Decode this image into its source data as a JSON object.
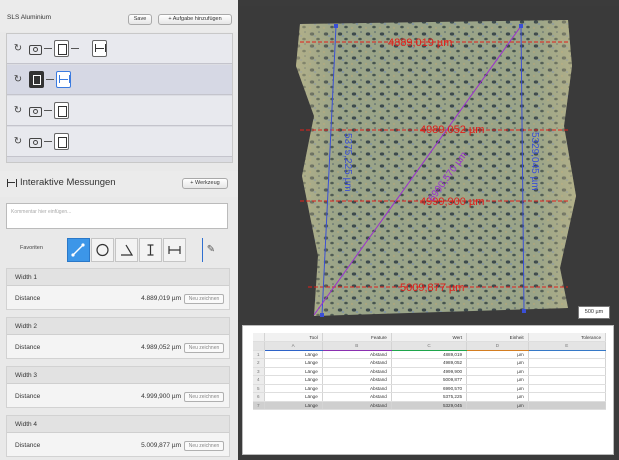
{
  "left": {
    "project_title": "SLS Aluminium",
    "save_label": "Save",
    "add_task_label": "+ Aufgabe hinzufügen"
  },
  "interactive": {
    "title": "Interaktive Messungen",
    "tool_button": "+ Werkzeug",
    "comment_placeholder": "Kommentar hier einfügen...",
    "favorites_label": "Favoriten",
    "tools": [
      "diagonal-measure-icon",
      "circle-icon",
      "angle-icon",
      "height-icon",
      "width-icon"
    ],
    "pencil_icon": "pencil-icon"
  },
  "measurements": [
    {
      "name": "Width 1",
      "key": "Distance",
      "value": "4.889,019 µm",
      "redraw": "Neu zeichnen"
    },
    {
      "name": "Width 2",
      "key": "Distance",
      "value": "4.989,052 µm",
      "redraw": "Neu zeichnen"
    },
    {
      "name": "Width 3",
      "key": "Distance",
      "value": "4.999,900 µm",
      "redraw": "Neu zeichnen"
    },
    {
      "name": "Width 4",
      "key": "Distance",
      "value": "5.009,877 µm",
      "redraw": "Neu zeichnen"
    }
  ],
  "image": {
    "labels": {
      "w1": "4889,019 µm",
      "w2": "4989,052 µm",
      "w3": "4999,900 µm",
      "w4": "5009,877 µm",
      "diag": "6990,570 µm",
      "h1": "5375,225 µm",
      "h2": "5329,045 µm"
    },
    "scale_bar": "500 µm"
  },
  "table": {
    "headers": [
      "Tool",
      "Feature",
      "Wert",
      "Einheit",
      "Tolerance"
    ],
    "letters": [
      "A",
      "B",
      "C",
      "D",
      "E"
    ],
    "rows": [
      {
        "idx": "1",
        "tool": "Länge",
        "feature": "Abstand",
        "wert": "4889,019",
        "unit": "µm"
      },
      {
        "idx": "2",
        "tool": "Länge",
        "feature": "Abstand",
        "wert": "4989,052",
        "unit": "µm"
      },
      {
        "idx": "3",
        "tool": "Länge",
        "feature": "Abstand",
        "wert": "4999,900",
        "unit": "µm"
      },
      {
        "idx": "4",
        "tool": "Länge",
        "feature": "Abstand",
        "wert": "5009,877",
        "unit": "µm"
      },
      {
        "idx": "5",
        "tool": "Länge",
        "feature": "Abstand",
        "wert": "6990,570",
        "unit": "µm"
      },
      {
        "idx": "6",
        "tool": "Länge",
        "feature": "Abstand",
        "wert": "5375,225",
        "unit": "µm"
      },
      {
        "idx": "7",
        "tool": "Länge",
        "feature": "Abstand",
        "wert": "5329,045",
        "unit": "µm"
      }
    ]
  },
  "colors": {
    "accent_blue": "#3c96e8",
    "measure_red": "#e0201b",
    "measure_blue": "#3a4fd6",
    "measure_purple": "#9b2fd0"
  }
}
